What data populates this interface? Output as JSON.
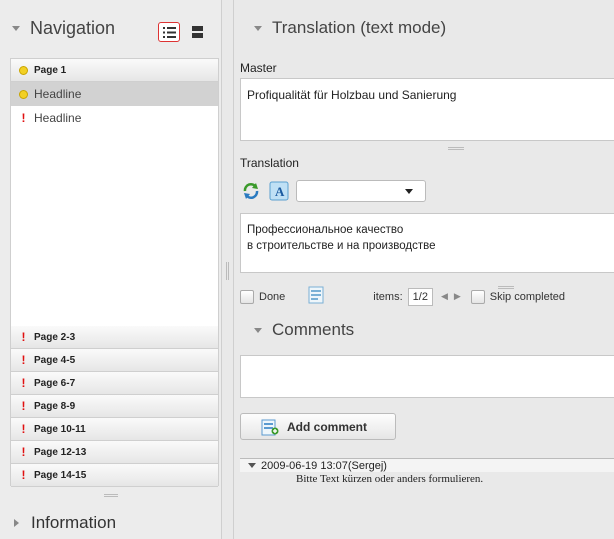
{
  "navigation": {
    "title": "Navigation",
    "view_modes": [
      "list-view",
      "grid-view"
    ],
    "active_view": "list-view",
    "current_page": {
      "label": "Page 1",
      "status": "yellow",
      "items": [
        {
          "label": "Headline",
          "status": "yellow",
          "selected": true
        },
        {
          "label": "Headline",
          "status": "warning",
          "selected": false
        }
      ]
    },
    "page_groups": [
      {
        "label": "Page 2-3",
        "status": "warning"
      },
      {
        "label": "Page 4-5",
        "status": "warning"
      },
      {
        "label": "Page 6-7",
        "status": "warning"
      },
      {
        "label": "Page 8-9",
        "status": "warning"
      },
      {
        "label": "Page 10-11",
        "status": "warning"
      },
      {
        "label": "Page 12-13",
        "status": "warning"
      },
      {
        "label": "Page 14-15",
        "status": "warning"
      }
    ]
  },
  "information": {
    "title": "Information"
  },
  "translation": {
    "title": "Translation (text mode)",
    "master_label": "Master",
    "master_text": "Profiqualität für Holzbau und Sanierung",
    "translation_label": "Translation",
    "language_value": "",
    "translation_lines": [
      "Профессиональное качество",
      "в строительстве и на производстве"
    ],
    "done_label": "Done",
    "items_label": "items:",
    "pager_value": "1/2",
    "skip_label": "Skip completed"
  },
  "comments": {
    "title": "Comments",
    "input_value": "",
    "add_button_label": "Add comment",
    "entries": [
      {
        "meta": "2009-06-19 13:07(Sergej)",
        "text": "Bitte Text kürzen oder anders formulieren."
      }
    ]
  },
  "colors": {
    "warning": "#e01010",
    "yellow_dot": "#f2d024",
    "active_border": "#dd3333"
  }
}
